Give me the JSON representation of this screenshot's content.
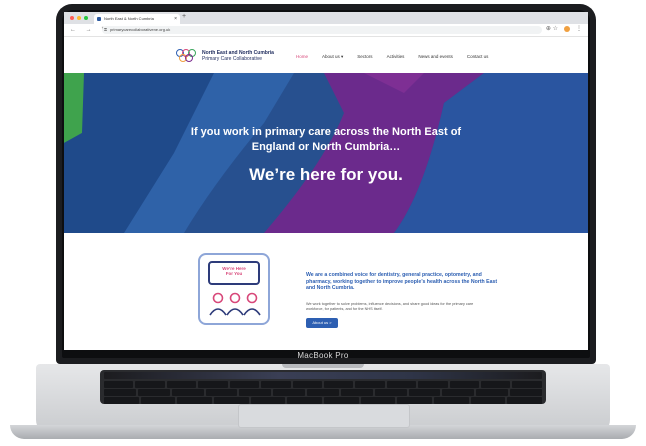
{
  "browser": {
    "tab_title": "North East & North Cumbria",
    "tab_close": "×",
    "new_tab": "+",
    "url": "primarycarecollaborativene.org.uk",
    "nav_controls": "← → ↻",
    "tool_icons": "⊕ ☆"
  },
  "site": {
    "org_name_line1": "North East and North Cumbria",
    "org_name_line2": "Primary Care Collaborative",
    "nav": [
      {
        "label": "Home",
        "active": true
      },
      {
        "label": "About us ▾",
        "active": false
      },
      {
        "label": "Sectors",
        "active": false
      },
      {
        "label": "Activities",
        "active": false
      },
      {
        "label": "News and events",
        "active": false
      },
      {
        "label": "Contact us",
        "active": false
      }
    ],
    "hero": {
      "line1": "If you work in primary care across the North East of",
      "line1b": "England or North Cumbria…",
      "line2": "We’re here for you."
    },
    "card": {
      "bubble_text_1": "We’re Here",
      "bubble_text_2": "For You"
    },
    "intro": {
      "heading": "We are a combined voice for dentistry, general practice, optometry, and pharmacy, working together to improve people’s health across the North East and North Cumbria.",
      "body": "We work together to solve problems, influence decisions, and share good ideas for the primary care workforce, for patients, and for the NHS itself.",
      "button": "About us  >"
    }
  },
  "device": {
    "brand": "MacBook Pro"
  },
  "colors": {
    "hero_blue": "#27508f",
    "magenta": "#7a2a8e",
    "accent_pink": "#d8487a",
    "link_blue": "#2d5fb2"
  }
}
